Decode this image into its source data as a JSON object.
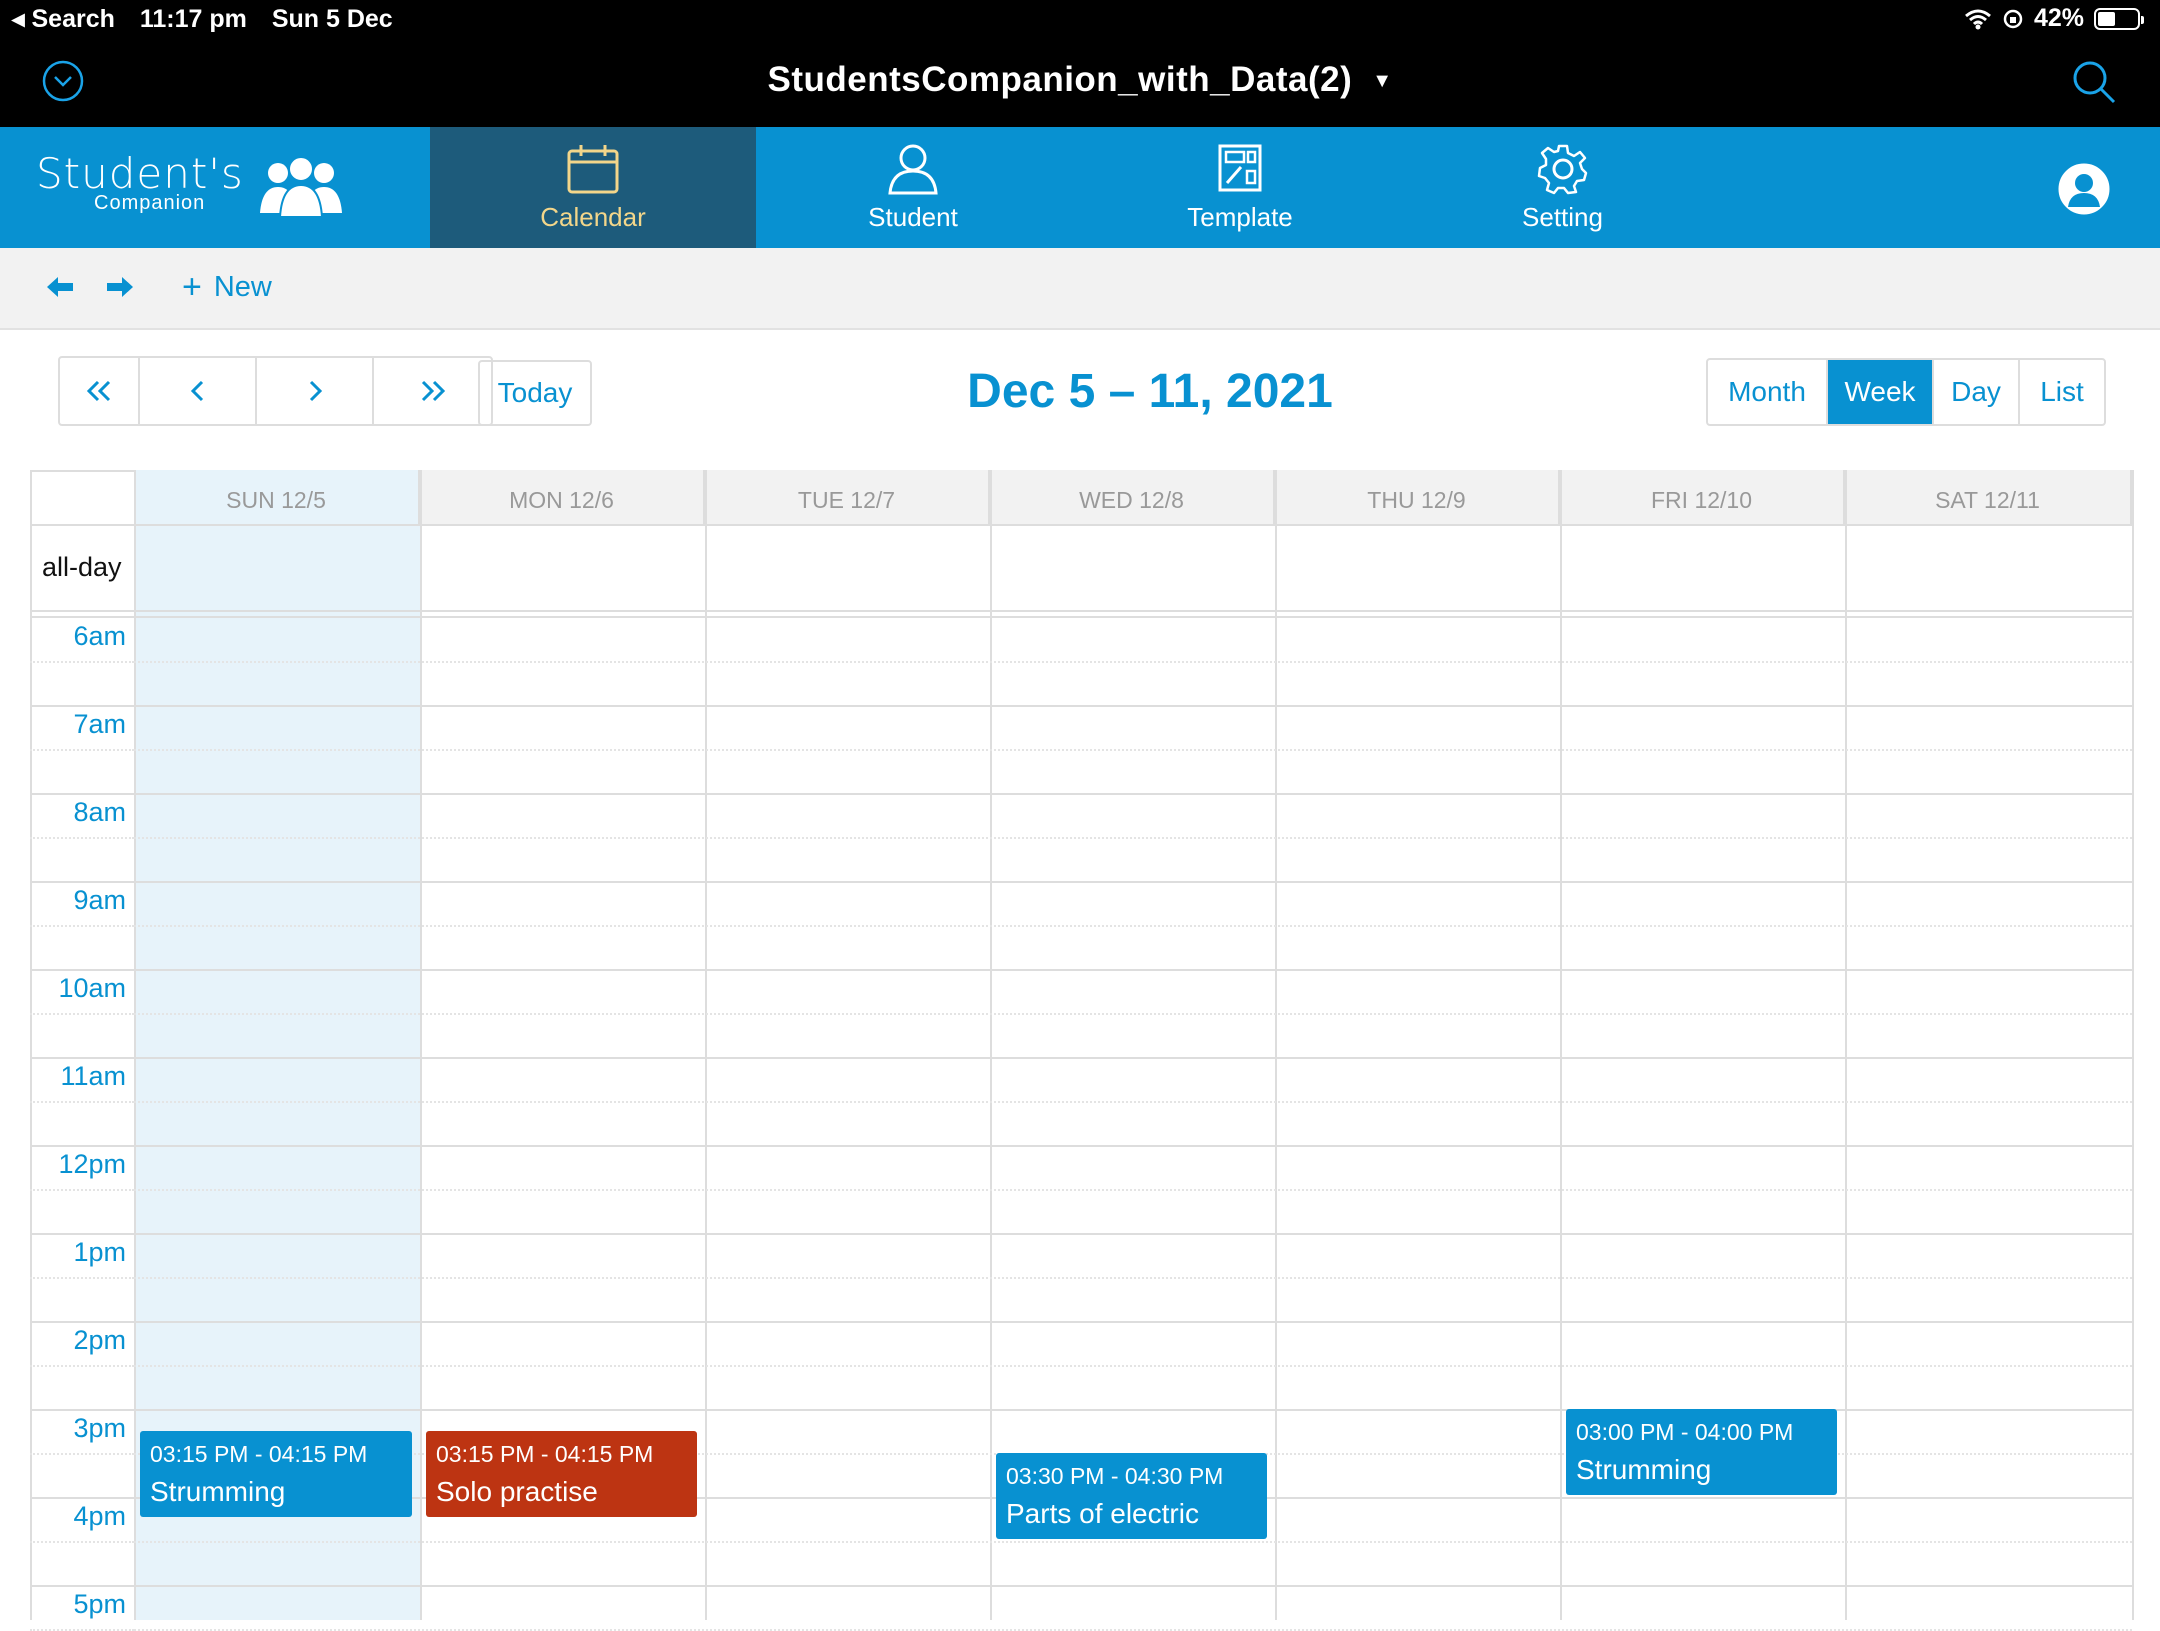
{
  "status_bar": {
    "back_app": "◂ Search",
    "time": "11:17 pm",
    "date": "Sun 5 Dec",
    "battery": "42%"
  },
  "app_bar": {
    "document_title": "StudentsCompanion_with_Data(2)"
  },
  "logo": {
    "line1": "Student's",
    "line2": "Companion"
  },
  "nav": {
    "tabs": [
      {
        "label": "Calendar",
        "active": true
      },
      {
        "label": "Student"
      },
      {
        "label": "Template"
      },
      {
        "label": "Setting"
      }
    ]
  },
  "toolbar": {
    "new_label": "New"
  },
  "calendar": {
    "today_label": "Today",
    "range_title": "Dec 5 – 11, 2021",
    "views": [
      "Month",
      "Week",
      "Day",
      "List"
    ],
    "active_view": "Week",
    "days": [
      "SUN 12/5",
      "MON 12/6",
      "TUE 12/7",
      "WED 12/8",
      "THU 12/9",
      "FRI 12/10",
      "SAT 12/11"
    ],
    "allday_label": "all-day",
    "hours": [
      "6am",
      "7am",
      "8am",
      "9am",
      "10am",
      "11am",
      "12pm",
      "1pm",
      "2pm",
      "3pm",
      "4pm",
      "5pm"
    ],
    "events": [
      {
        "time": "03:15 PM - 04:15 PM",
        "name": "Strumming",
        "color": "#0891d1"
      },
      {
        "time": "03:15 PM - 04:15 PM",
        "name": "Solo practise",
        "color": "#bd3412"
      },
      {
        "time": "03:30 PM - 04:30 PM",
        "name": "Parts of electric",
        "color": "#0891d1"
      },
      {
        "time": "03:00 PM - 04:00 PM",
        "name": "Strumming",
        "color": "#0891d1"
      }
    ]
  },
  "colors": {
    "brand": "#0891d1",
    "active_tab_bg": "#1d5b7b",
    "active_tab_text": "#f3d68a",
    "today_col": "#e7f3fa"
  }
}
